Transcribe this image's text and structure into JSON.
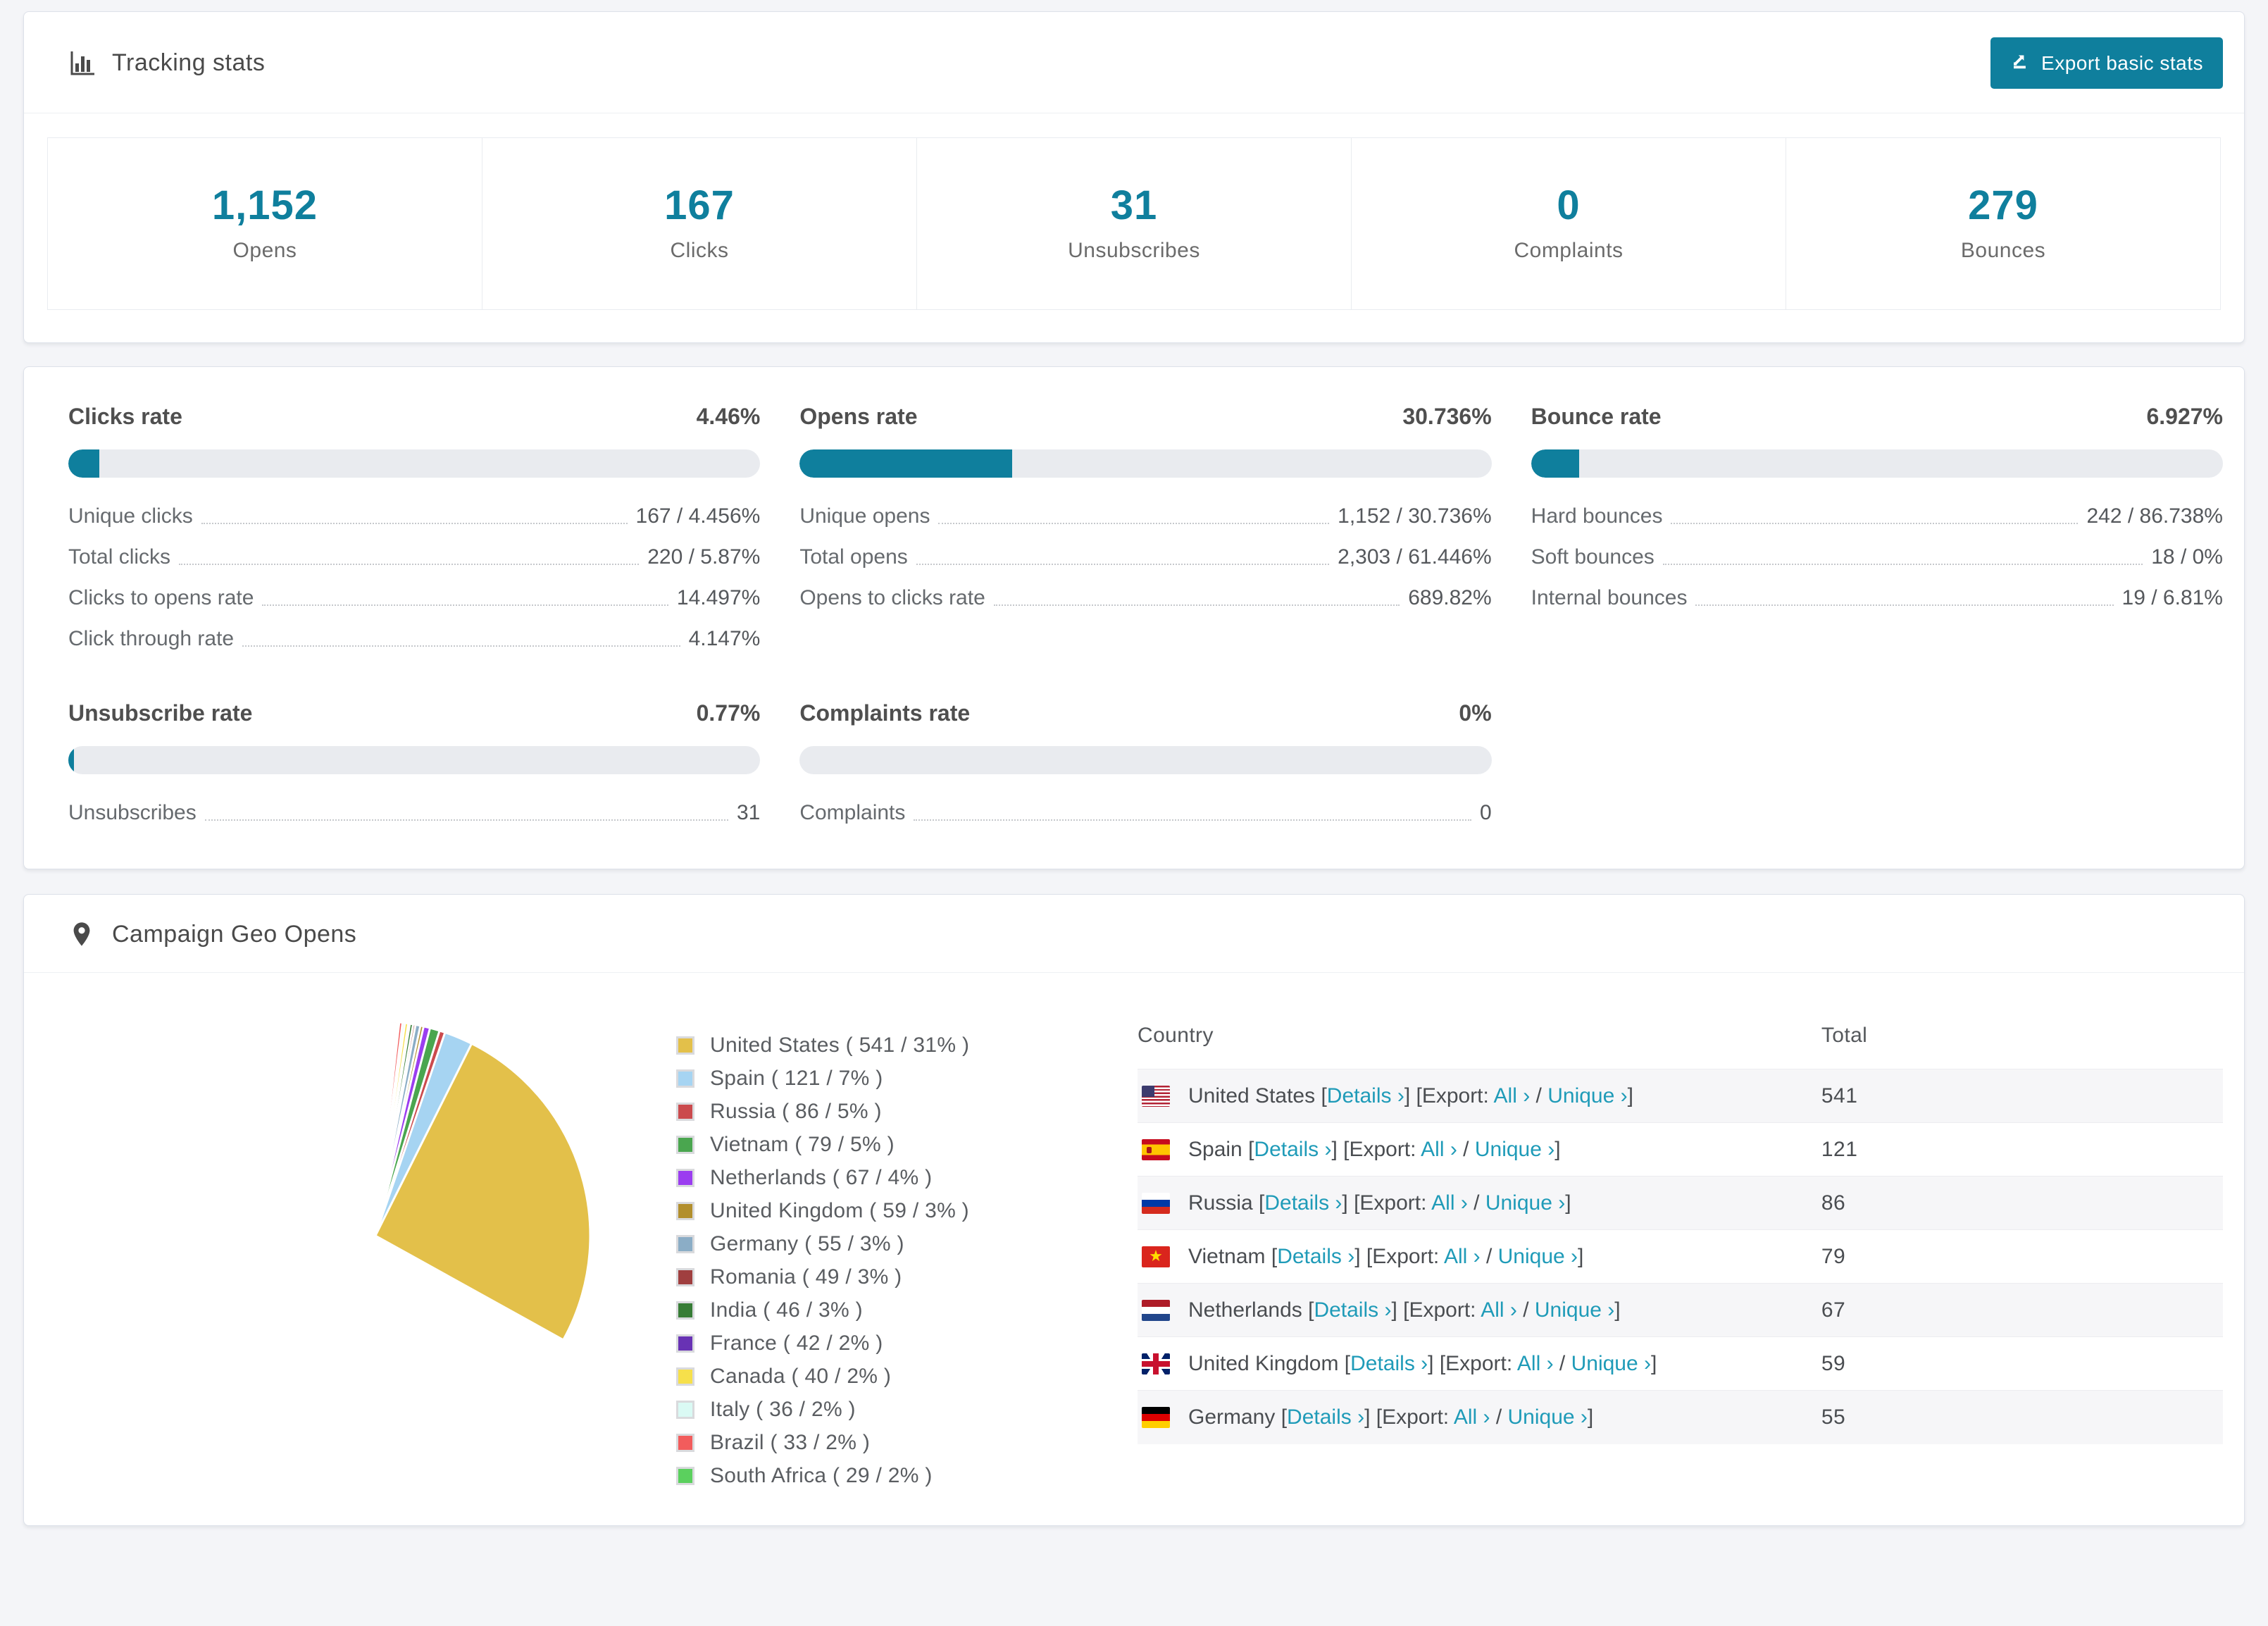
{
  "colors": {
    "accent_teal": "#0f7f9d",
    "link_teal": "#1f9bb8",
    "bar_track": "#e9ebef",
    "row_stripe": "#f6f6f8",
    "page_bg": "#f4f5f8"
  },
  "tracking": {
    "title": "Tracking stats",
    "export_button": "Export basic stats",
    "stats": [
      {
        "value": "1,152",
        "label": "Opens"
      },
      {
        "value": "167",
        "label": "Clicks"
      },
      {
        "value": "31",
        "label": "Unsubscribes"
      },
      {
        "value": "0",
        "label": "Complaints"
      },
      {
        "value": "279",
        "label": "Bounces"
      }
    ]
  },
  "rates": {
    "groups": [
      {
        "title": "Clicks rate",
        "value": "4.46%",
        "percent": 4.46,
        "rows": [
          {
            "label": "Unique clicks",
            "value": "167 / 4.456%"
          },
          {
            "label": "Total clicks",
            "value": "220 / 5.87%"
          },
          {
            "label": "Clicks to opens rate",
            "value": "14.497%"
          },
          {
            "label": "Click through rate",
            "value": "4.147%"
          }
        ]
      },
      {
        "title": "Opens rate",
        "value": "30.736%",
        "percent": 30.736,
        "rows": [
          {
            "label": "Unique opens",
            "value": "1,152 / 30.736%"
          },
          {
            "label": "Total opens",
            "value": "2,303 / 61.446%"
          },
          {
            "label": "Opens to clicks rate",
            "value": "689.82%"
          }
        ]
      },
      {
        "title": "Bounce rate",
        "value": "6.927%",
        "percent": 6.927,
        "rows": [
          {
            "label": "Hard bounces",
            "value": "242 / 86.738%"
          },
          {
            "label": "Soft bounces",
            "value": "18 / 0%"
          },
          {
            "label": "Internal bounces",
            "value": "19 / 6.81%"
          }
        ]
      },
      {
        "title": "Unsubscribe rate",
        "value": "0.77%",
        "percent": 0.77,
        "rows": [
          {
            "label": "Unsubscribes",
            "value": "31"
          }
        ]
      },
      {
        "title": "Complaints rate",
        "value": "0%",
        "percent": 0,
        "rows": [
          {
            "label": "Complaints",
            "value": "0"
          }
        ]
      }
    ]
  },
  "geo": {
    "title": "Campaign Geo Opens",
    "legend": [
      {
        "label": "United States ( 541 / 31% )",
        "color": "#e3c04a"
      },
      {
        "label": "Spain ( 121 / 7% )",
        "color": "#a6d4f2"
      },
      {
        "label": "Russia ( 86 / 5% )",
        "color": "#cb4a4d"
      },
      {
        "label": "Vietnam ( 79 / 5% )",
        "color": "#4aa64f"
      },
      {
        "label": "Netherlands ( 67 / 4% )",
        "color": "#9b3df0"
      },
      {
        "label": "United Kingdom ( 59 / 3% )",
        "color": "#b28f2d"
      },
      {
        "label": "Germany ( 55 / 3% )",
        "color": "#8badc6"
      },
      {
        "label": "Romania ( 49 / 3% )",
        "color": "#a03f3f"
      },
      {
        "label": "India ( 46 / 3% )",
        "color": "#377d36"
      },
      {
        "label": "France ( 42 / 2% )",
        "color": "#6832b4"
      },
      {
        "label": "Canada ( 40 / 2% )",
        "color": "#f6e04b"
      },
      {
        "label": "Italy ( 36 / 2% )",
        "color": "#dafaf4"
      },
      {
        "label": "Brazil ( 33 / 2% )",
        "color": "#f25c5c"
      },
      {
        "label": "South Africa ( 29 / 2% )",
        "color": "#5bd05e"
      }
    ],
    "table": {
      "columns": [
        "Country",
        "Total"
      ],
      "links": {
        "open_bracket": "[",
        "details": "Details ›",
        "close_bracket": "]",
        "export_prefix": "[Export:",
        "all": "All ›",
        "slash": "/",
        "unique": "Unique ›",
        "export_close": "]"
      },
      "rows": [
        {
          "country": "United States",
          "flag": "us",
          "total": "541"
        },
        {
          "country": "Spain",
          "flag": "es",
          "total": "121"
        },
        {
          "country": "Russia",
          "flag": "ru",
          "total": "86"
        },
        {
          "country": "Vietnam",
          "flag": "vn",
          "total": "79"
        },
        {
          "country": "Netherlands",
          "flag": "nl",
          "total": "67"
        },
        {
          "country": "United Kingdom",
          "flag": "gb",
          "total": "59"
        },
        {
          "country": "Germany",
          "flag": "de",
          "total": "55"
        }
      ]
    }
  },
  "chart_data": {
    "type": "pie",
    "title": "Campaign Geo Opens",
    "legend_position": "right",
    "start_angle_deg": -90,
    "direction": "clockwise",
    "slices": [
      {
        "name": "United States",
        "value": 541,
        "pct_label": "31%",
        "color": "#e3c04a"
      },
      {
        "name": "Spain",
        "value": 121,
        "pct_label": "7%",
        "color": "#a6d4f2"
      },
      {
        "name": "Russia",
        "value": 86,
        "pct_label": "5%",
        "color": "#cb4a4d"
      },
      {
        "name": "Vietnam",
        "value": 79,
        "pct_label": "5%",
        "color": "#4aa64f"
      },
      {
        "name": "Netherlands",
        "value": 67,
        "pct_label": "4%",
        "color": "#9b3df0"
      },
      {
        "name": "United Kingdom",
        "value": 59,
        "pct_label": "3%",
        "color": "#b28f2d"
      },
      {
        "name": "Germany",
        "value": 55,
        "pct_label": "3%",
        "color": "#8badc6"
      },
      {
        "name": "Romania",
        "value": 49,
        "pct_label": "3%",
        "color": "#a03f3f"
      },
      {
        "name": "India",
        "value": 46,
        "pct_label": "3%",
        "color": "#377d36"
      },
      {
        "name": "France",
        "value": 42,
        "pct_label": "2%",
        "color": "#6832b4"
      },
      {
        "name": "Canada",
        "value": 40,
        "pct_label": "2%",
        "color": "#f6e04b"
      },
      {
        "name": "Italy",
        "value": 36,
        "pct_label": "2%",
        "color": "#dafaf4"
      },
      {
        "name": "Brazil",
        "value": 33,
        "pct_label": "2%",
        "color": "#f25c5c"
      },
      {
        "name": "South Africa",
        "value": 29,
        "pct_label": "2%",
        "color": "#5bd05e"
      }
    ],
    "unlabeled_small_slices_estimated": [
      27,
      25,
      23,
      21,
      20,
      18,
      17,
      16,
      15,
      14,
      13,
      12,
      11,
      10,
      9.5,
      9,
      8.5,
      8,
      7.5,
      7,
      6.5,
      6,
      5.5,
      5,
      4.5,
      4,
      3.7,
      3.4,
      3.1,
      2.8,
      2.5,
      2.2,
      2,
      1.8,
      1.6,
      1.4,
      1.2,
      1,
      0.9,
      0.8,
      0.7,
      0.6,
      0.5,
      0.4
    ]
  }
}
